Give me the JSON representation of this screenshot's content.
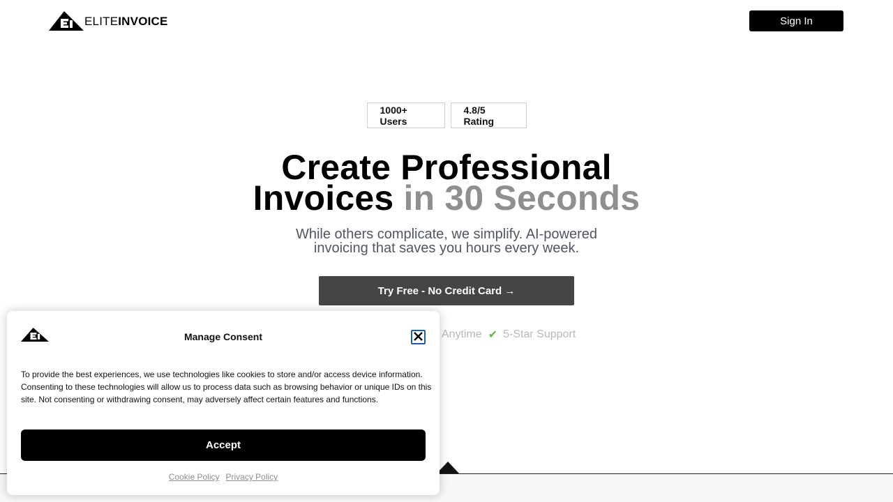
{
  "header": {
    "logo_elite": "ELITE",
    "logo_invoice": "INVOICE",
    "signin_label": "Sign In"
  },
  "hero": {
    "badges": [
      "1000+ Users",
      "4.8/5 Rating"
    ],
    "headline_line1": "Create Professional",
    "headline_line2_dark": "Invoices",
    "headline_line2_grey": "in 30 Seconds",
    "subhead_line1": "While others complicate, we simplify. AI-powered",
    "subhead_line2": "invoicing that saves you hours every week.",
    "cta_label": "Try Free - No Credit Card →",
    "feature_1": "ncel Anytime",
    "feature_2": "5-Star Support"
  },
  "consent": {
    "title": "Manage Consent",
    "body": "To provide the best experiences, we use technologies like cookies to store and/or access device information. Consenting to these technologies will allow us to process data such as browsing behavior or unique IDs on this site. Not consenting or withdrawing consent, may adversely affect certain features and functions.",
    "accept_label": "Accept",
    "cookie_policy": "Cookie Policy",
    "privacy_policy": "Privacy Policy"
  },
  "icons": {
    "logo": "elite-logo-icon",
    "close": "close-icon",
    "check": "check-icon"
  },
  "colors": {
    "accent_check": "#5cbb3d",
    "cta_bg": "#454545",
    "close_border": "#1f5fa8"
  }
}
